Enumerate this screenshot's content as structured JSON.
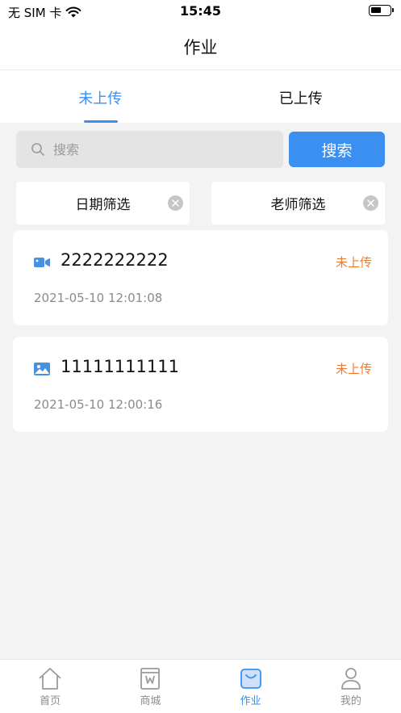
{
  "status_bar": {
    "carrier": "无 SIM 卡",
    "time": "15:45"
  },
  "nav": {
    "title": "作业"
  },
  "tabs": [
    {
      "label": "未上传",
      "active": true
    },
    {
      "label": "已上传",
      "active": false
    }
  ],
  "search": {
    "placeholder": "搜索",
    "button_label": "搜索"
  },
  "filters": {
    "date_label": "日期筛选",
    "teacher_label": "老师筛选"
  },
  "assignments": [
    {
      "title": "2222222222",
      "status": "未上传",
      "time": "2021-05-10 12:01:08",
      "icon": "video-icon"
    },
    {
      "title": "11111111111",
      "status": "未上传",
      "time": "2021-05-10 12:00:16",
      "icon": "image-icon"
    }
  ],
  "bottom_tabs": [
    {
      "label": "首页",
      "icon": "home-icon",
      "active": false
    },
    {
      "label": "商城",
      "icon": "shop-icon",
      "active": false
    },
    {
      "label": "作业",
      "icon": "homework-icon",
      "active": true
    },
    {
      "label": "我的",
      "icon": "profile-icon",
      "active": false
    }
  ],
  "colors": {
    "accent": "#3a8ff0",
    "status_pending": "#ef7c2c",
    "background": "#f3f3f3"
  }
}
